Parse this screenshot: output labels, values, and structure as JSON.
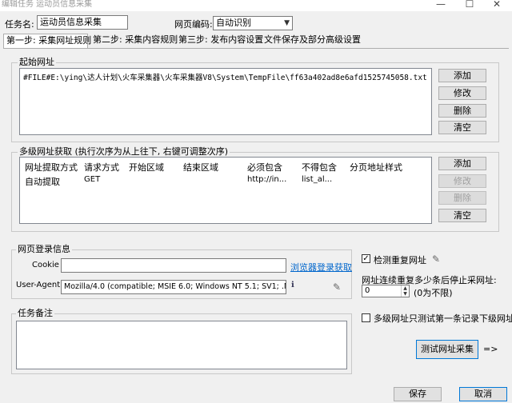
{
  "window": {
    "title": "编辑任务 运动员信息采集"
  },
  "header": {
    "task_name_label": "任务名:",
    "task_name_value": "运动员信息采集",
    "encoding_label": "网页编码:",
    "encoding_value": "自动识别"
  },
  "tabs": [
    {
      "label": "第一步: 采集网址规则"
    },
    {
      "label": "第二步: 采集内容规则"
    },
    {
      "label": "第三步: 发布内容设置"
    },
    {
      "label": "文件保存及部分高级设置"
    }
  ],
  "start_url": {
    "title": "起始网址",
    "entries": [
      "#FILE#E:\\ying\\达人计划\\火车采集器\\火车采集器V8\\System\\TempFile\\ff63a402ad8e6afd1525745058.txt"
    ],
    "buttons": {
      "add": "添加",
      "edit": "修改",
      "delete": "删除",
      "clear": "清空"
    }
  },
  "multi_level": {
    "title": "多级网址获取 (执行次序为从上往下, 右键可调整次序)",
    "columns": [
      "网址提取方式",
      "请求方式",
      "开始区域",
      "结束区域",
      "必须包含",
      "不得包含",
      "分页地址样式"
    ],
    "rows": [
      [
        "自动提取",
        "GET",
        "",
        "",
        "http://in...",
        "list_al...",
        ""
      ]
    ],
    "buttons": {
      "add": "添加",
      "edit": "修改",
      "delete": "删除",
      "clear": "清空"
    }
  },
  "login": {
    "title": "网页登录信息",
    "cookie_label": "Cookie",
    "cookie_value": "",
    "browser_link": "浏览器登录获取",
    "ua_label": "User-Agent",
    "ua_value": "Mozilla/4.0 (compatible; MSIE 6.0; Windows NT 5.1; SV1; .NET",
    "ua_info_glyph": "ℹ"
  },
  "options": {
    "dup_check_label": "检测重复网址",
    "dup_check_checked": true,
    "dup_check_mark": "✓",
    "repeat_stop_label": "网址连续重复多少条后停止采网址:",
    "repeat_stop_value": "0",
    "repeat_stop_hint": "(0为不限)",
    "multi_first_label": "多级网址只测试第一条记录下级网址",
    "multi_first_checked": false,
    "help_glyph": "✎",
    "test_button": "测试网址采集",
    "test_arrow": "=>"
  },
  "notes": {
    "title": "任务备注",
    "value": ""
  },
  "footer": {
    "save": "保存",
    "cancel": "取消"
  },
  "window_controls": {
    "minimize": "—",
    "maximize": "☐",
    "close": "✕"
  }
}
